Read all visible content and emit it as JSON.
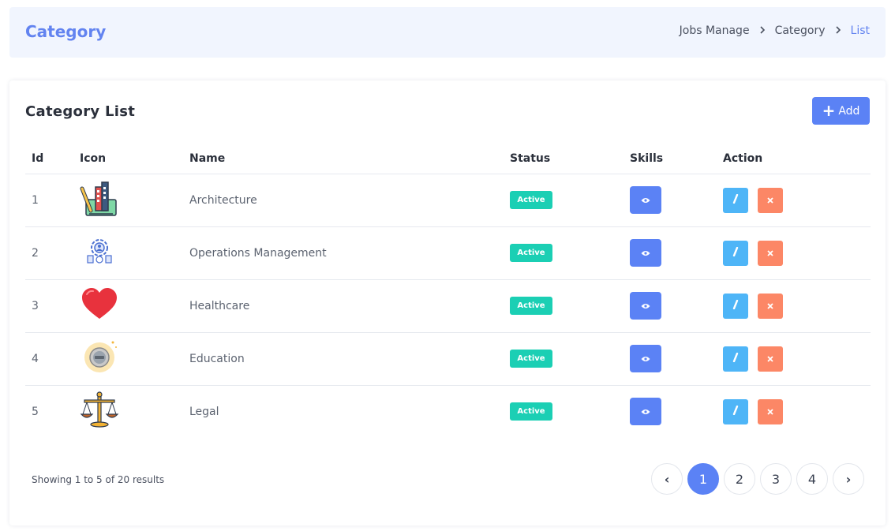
{
  "header": {
    "title": "Category",
    "breadcrumb": [
      "Jobs Manage",
      "Category",
      "List"
    ]
  },
  "card": {
    "title": "Category List",
    "add_label": "Add"
  },
  "table": {
    "columns": [
      "Id",
      "Icon",
      "Name",
      "Status",
      "Skills",
      "Action"
    ],
    "rows": [
      {
        "id": "1",
        "icon": "architecture-icon",
        "name": "Architecture",
        "status": "Active"
      },
      {
        "id": "2",
        "icon": "operations-gear-icon",
        "name": "Operations Management",
        "status": "Active"
      },
      {
        "id": "3",
        "icon": "heart-icon",
        "name": "Healthcare",
        "status": "Active"
      },
      {
        "id": "4",
        "icon": "education-badge-icon",
        "name": "Education",
        "status": "Active"
      },
      {
        "id": "5",
        "icon": "scales-of-justice-icon",
        "name": "Legal",
        "status": "Active"
      }
    ]
  },
  "footer": {
    "showing": "Showing 1 to 5 of 20 results"
  },
  "pagination": {
    "prev": "‹",
    "pages": [
      "1",
      "2",
      "3",
      "4"
    ],
    "current": "1",
    "next": "›"
  },
  "colors": {
    "accent": "#5b82f5",
    "title": "#6283f0",
    "active_badge": "#1bcfb4",
    "edit": "#4eb5f7",
    "delete": "#fc8766"
  }
}
